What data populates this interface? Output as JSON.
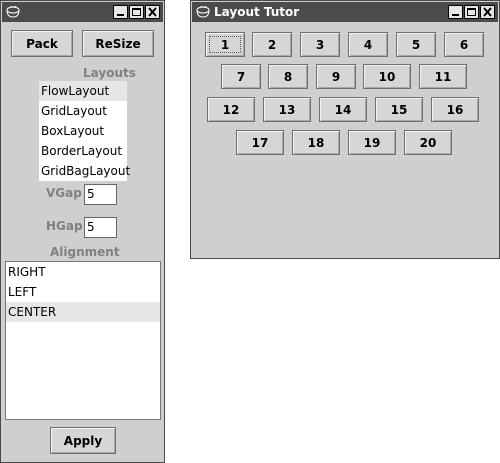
{
  "control_window": {
    "title": "",
    "buttons": {
      "pack": "Pack",
      "resize": "ReSize",
      "apply": "Apply"
    },
    "layouts": {
      "heading": "Layouts",
      "items": [
        "FlowLayout",
        "GridLayout",
        "BoxLayout",
        "BorderLayout",
        "GridBagLayout"
      ],
      "selected": "FlowLayout"
    },
    "vgap": {
      "label": "VGap",
      "value": "5"
    },
    "hgap": {
      "label": "HGap",
      "value": "5"
    },
    "alignment": {
      "heading": "Alignment",
      "items": [
        "RIGHT",
        "LEFT",
        "CENTER"
      ],
      "selected": "CENTER"
    }
  },
  "tutor_window": {
    "title": "Layout Tutor",
    "buttons": [
      "1",
      "2",
      "3",
      "4",
      "5",
      "6",
      "7",
      "8",
      "9",
      "10",
      "11",
      "12",
      "13",
      "14",
      "15",
      "16",
      "17",
      "18",
      "19",
      "20"
    ],
    "focused": "1"
  },
  "icons": {
    "app": "java-cup-icon",
    "minimize": "minimize-icon",
    "maximize": "maximize-icon",
    "close": "close-icon"
  },
  "colors": {
    "titlebar": "#4b4b4b",
    "window": "#cfcfcf",
    "label_gray": "#808080",
    "selection": "#e6e6e6"
  }
}
